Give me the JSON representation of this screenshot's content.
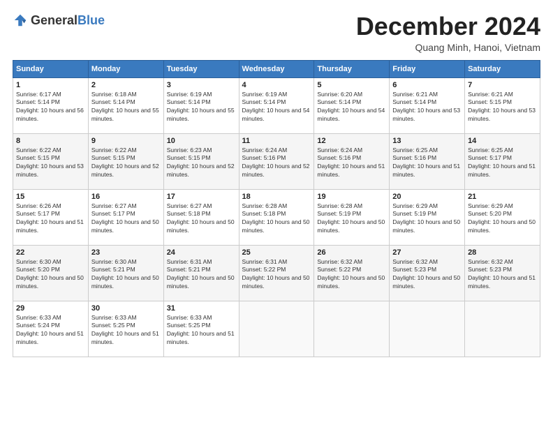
{
  "logo": {
    "general": "General",
    "blue": "Blue"
  },
  "header": {
    "title": "December 2024",
    "subtitle": "Quang Minh, Hanoi, Vietnam"
  },
  "weekdays": [
    "Sunday",
    "Monday",
    "Tuesday",
    "Wednesday",
    "Thursday",
    "Friday",
    "Saturday"
  ],
  "weeks": [
    [
      {
        "day": "1",
        "sunrise": "6:17 AM",
        "sunset": "5:14 PM",
        "daylight": "10 hours and 56 minutes."
      },
      {
        "day": "2",
        "sunrise": "6:18 AM",
        "sunset": "5:14 PM",
        "daylight": "10 hours and 55 minutes."
      },
      {
        "day": "3",
        "sunrise": "6:19 AM",
        "sunset": "5:14 PM",
        "daylight": "10 hours and 55 minutes."
      },
      {
        "day": "4",
        "sunrise": "6:19 AM",
        "sunset": "5:14 PM",
        "daylight": "10 hours and 54 minutes."
      },
      {
        "day": "5",
        "sunrise": "6:20 AM",
        "sunset": "5:14 PM",
        "daylight": "10 hours and 54 minutes."
      },
      {
        "day": "6",
        "sunrise": "6:21 AM",
        "sunset": "5:14 PM",
        "daylight": "10 hours and 53 minutes."
      },
      {
        "day": "7",
        "sunrise": "6:21 AM",
        "sunset": "5:15 PM",
        "daylight": "10 hours and 53 minutes."
      }
    ],
    [
      {
        "day": "8",
        "sunrise": "6:22 AM",
        "sunset": "5:15 PM",
        "daylight": "10 hours and 53 minutes."
      },
      {
        "day": "9",
        "sunrise": "6:22 AM",
        "sunset": "5:15 PM",
        "daylight": "10 hours and 52 minutes."
      },
      {
        "day": "10",
        "sunrise": "6:23 AM",
        "sunset": "5:15 PM",
        "daylight": "10 hours and 52 minutes."
      },
      {
        "day": "11",
        "sunrise": "6:24 AM",
        "sunset": "5:16 PM",
        "daylight": "10 hours and 52 minutes."
      },
      {
        "day": "12",
        "sunrise": "6:24 AM",
        "sunset": "5:16 PM",
        "daylight": "10 hours and 51 minutes."
      },
      {
        "day": "13",
        "sunrise": "6:25 AM",
        "sunset": "5:16 PM",
        "daylight": "10 hours and 51 minutes."
      },
      {
        "day": "14",
        "sunrise": "6:25 AM",
        "sunset": "5:17 PM",
        "daylight": "10 hours and 51 minutes."
      }
    ],
    [
      {
        "day": "15",
        "sunrise": "6:26 AM",
        "sunset": "5:17 PM",
        "daylight": "10 hours and 51 minutes."
      },
      {
        "day": "16",
        "sunrise": "6:27 AM",
        "sunset": "5:17 PM",
        "daylight": "10 hours and 50 minutes."
      },
      {
        "day": "17",
        "sunrise": "6:27 AM",
        "sunset": "5:18 PM",
        "daylight": "10 hours and 50 minutes."
      },
      {
        "day": "18",
        "sunrise": "6:28 AM",
        "sunset": "5:18 PM",
        "daylight": "10 hours and 50 minutes."
      },
      {
        "day": "19",
        "sunrise": "6:28 AM",
        "sunset": "5:19 PM",
        "daylight": "10 hours and 50 minutes."
      },
      {
        "day": "20",
        "sunrise": "6:29 AM",
        "sunset": "5:19 PM",
        "daylight": "10 hours and 50 minutes."
      },
      {
        "day": "21",
        "sunrise": "6:29 AM",
        "sunset": "5:20 PM",
        "daylight": "10 hours and 50 minutes."
      }
    ],
    [
      {
        "day": "22",
        "sunrise": "6:30 AM",
        "sunset": "5:20 PM",
        "daylight": "10 hours and 50 minutes."
      },
      {
        "day": "23",
        "sunrise": "6:30 AM",
        "sunset": "5:21 PM",
        "daylight": "10 hours and 50 minutes."
      },
      {
        "day": "24",
        "sunrise": "6:31 AM",
        "sunset": "5:21 PM",
        "daylight": "10 hours and 50 minutes."
      },
      {
        "day": "25",
        "sunrise": "6:31 AM",
        "sunset": "5:22 PM",
        "daylight": "10 hours and 50 minutes."
      },
      {
        "day": "26",
        "sunrise": "6:32 AM",
        "sunset": "5:22 PM",
        "daylight": "10 hours and 50 minutes."
      },
      {
        "day": "27",
        "sunrise": "6:32 AM",
        "sunset": "5:23 PM",
        "daylight": "10 hours and 50 minutes."
      },
      {
        "day": "28",
        "sunrise": "6:32 AM",
        "sunset": "5:23 PM",
        "daylight": "10 hours and 51 minutes."
      }
    ],
    [
      {
        "day": "29",
        "sunrise": "6:33 AM",
        "sunset": "5:24 PM",
        "daylight": "10 hours and 51 minutes."
      },
      {
        "day": "30",
        "sunrise": "6:33 AM",
        "sunset": "5:25 PM",
        "daylight": "10 hours and 51 minutes."
      },
      {
        "day": "31",
        "sunrise": "6:33 AM",
        "sunset": "5:25 PM",
        "daylight": "10 hours and 51 minutes."
      },
      null,
      null,
      null,
      null
    ]
  ]
}
